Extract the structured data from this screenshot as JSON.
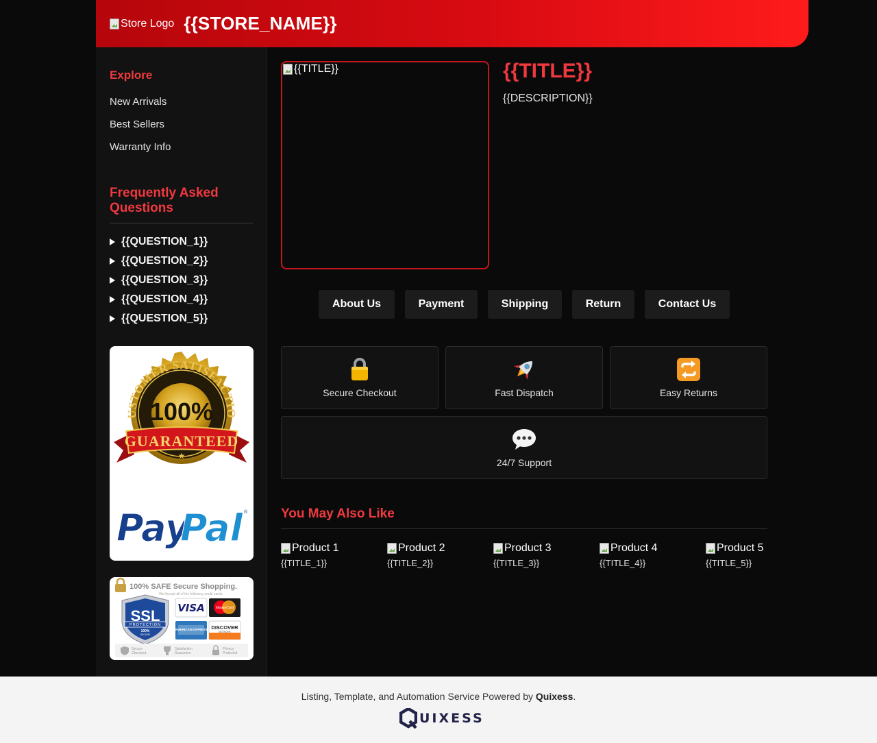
{
  "header": {
    "logo_alt": "Store Logo",
    "store_name": "{{STORE_NAME}}"
  },
  "sidebar": {
    "explore_heading": "Explore",
    "nav": [
      "New Arrivals",
      "Best Sellers",
      "Warranty Info"
    ],
    "faq_heading": "Frequently Asked Questions",
    "faq": [
      "{{QUESTION_1}}",
      "{{QUESTION_2}}",
      "{{QUESTION_3}}",
      "{{QUESTION_4}}",
      "{{QUESTION_5}}"
    ],
    "badge": {
      "ring_text": "CUSTOMER SATISFACTION",
      "percent": "100%",
      "ribbon": "GUARANTEED",
      "paypal_a": "Pay",
      "paypal_b": "Pal",
      "reg": "®"
    },
    "ssl": {
      "top": "100% SAFE Secure Shopping.",
      "sub": "We Accept all of the following credit cards:",
      "shield": "SSL",
      "shield_ring": "PROTECTION",
      "shield_pct": "100%",
      "shield_sub": "SECURE",
      "visa": "VISA",
      "mastercard": "MasterCard",
      "amex": "AMERICAN EXPRESS",
      "discover": "DISCOVER",
      "discover_sub": "NETWORK",
      "f1a": "Secure",
      "f1b": "Checkout",
      "f2a": "Satisfaction",
      "f2b": "Guarantee",
      "f3a": "Privacy",
      "f3b": "Protected"
    }
  },
  "product": {
    "image_alt": "{{TITLE}}",
    "title": "{{TITLE}}",
    "description": "{{DESCRIPTION}}"
  },
  "tabs": [
    "About Us",
    "Payment",
    "Shipping",
    "Return",
    "Contact Us"
  ],
  "features": [
    {
      "icon": "lock-icon",
      "label": "Secure Checkout"
    },
    {
      "icon": "rocket-icon",
      "label": "Fast Dispatch"
    },
    {
      "icon": "repeat-icon",
      "label": "Easy Returns"
    },
    {
      "icon": "speech-bubble-icon",
      "label": "24/7 Support"
    }
  ],
  "related": {
    "heading": "You May Also Like",
    "items": [
      {
        "alt": "Product 1",
        "title": "{{TITLE_1}}"
      },
      {
        "alt": "Product 2",
        "title": "{{TITLE_2}}"
      },
      {
        "alt": "Product 3",
        "title": "{{TITLE_3}}"
      },
      {
        "alt": "Product 4",
        "title": "{{TITLE_4}}"
      },
      {
        "alt": "Product 5",
        "title": "{{TITLE_5}}"
      }
    ]
  },
  "footer": {
    "text_before": "Listing, Template, and Automation Service Powered by ",
    "brand": "Quixess",
    "text_after": ".",
    "logo_text": "UIXESS"
  },
  "colors": {
    "accent": "#f0393f",
    "header_red": "#d90b12",
    "bg": "#0a0a0a",
    "footer_bg": "#f4f4f4"
  }
}
